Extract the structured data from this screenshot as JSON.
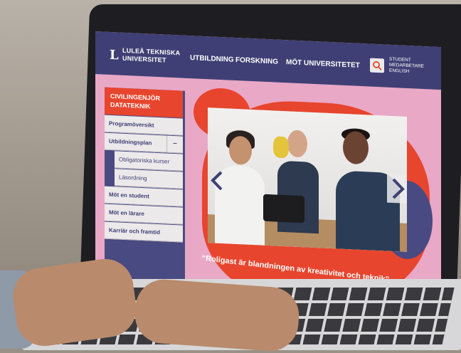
{
  "header": {
    "logo_mark": "L",
    "logo_line1": "LULEÅ TEKNISKA",
    "logo_line2": "UNIVERSITET",
    "nav": [
      "UTBILDNING",
      "FORSKNING",
      "MÖT UNIVERSITETET"
    ],
    "search_icon": "search-icon",
    "top_links": [
      "STUDENT",
      "MEDARBETARE",
      "ENGLISH"
    ]
  },
  "sidebar": {
    "heading_line1": "CIVILINGENJÖR",
    "heading_line2": "DATATEKNIK",
    "items": [
      {
        "label": "Programöversikt",
        "level": 1
      },
      {
        "label": "Utbildningsplan",
        "level": 1,
        "toggle": "–"
      },
      {
        "label": "Obligatoriska kurser",
        "level": 2
      },
      {
        "label": "Läsordning",
        "level": 2
      },
      {
        "label": "Möt en student",
        "level": 1
      },
      {
        "label": "Möt en lärare",
        "level": 1
      },
      {
        "label": "Karriär och framtid",
        "level": 1
      }
    ]
  },
  "hero": {
    "quote": "“Roligast är blandningen av kreativitet och teknik”",
    "prev_icon": "chevron-left-icon",
    "next_icon": "chevron-right-icon"
  },
  "colors": {
    "topbar": "#3f3f75",
    "accent": "#e8452e",
    "background": "#e9a8c6",
    "sidebar_item": "#ece9ea"
  }
}
